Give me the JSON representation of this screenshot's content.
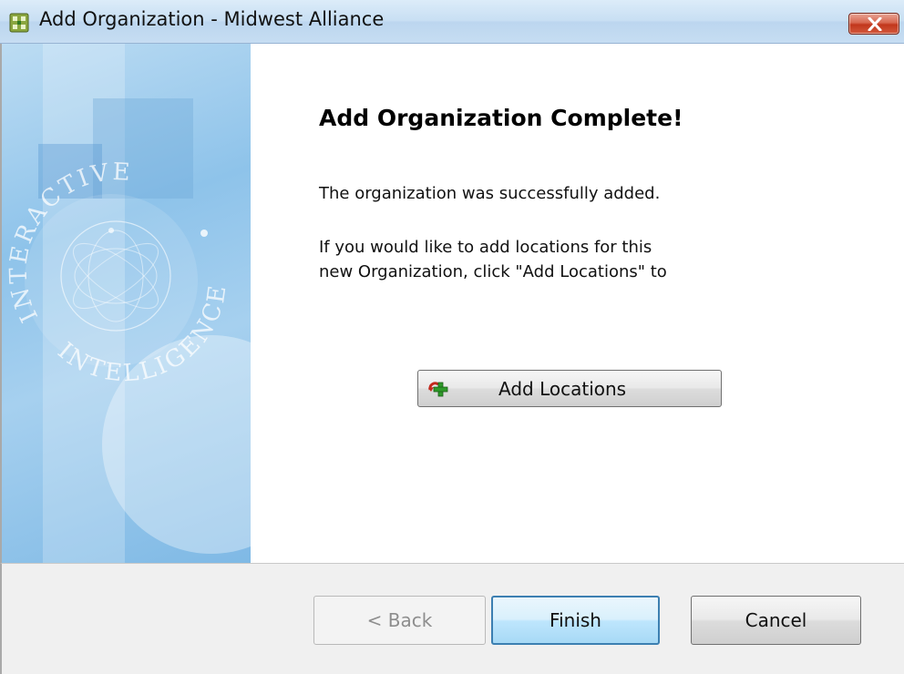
{
  "window": {
    "title": "Add Organization - Midwest Alliance",
    "icon": "app-grid-icon",
    "close_icon": "close-icon"
  },
  "banner": {
    "watermark_text": [
      "INTERACTIVE",
      "INTELLIGENCE"
    ],
    "colors": {
      "light": "#bcdcf3",
      "mid": "#8ec3ea",
      "dark": "#7fb9e5"
    }
  },
  "content": {
    "heading": "Add Organization Complete!",
    "message_1": "The organization was successfully added.",
    "message_2_line_1": "If you would like to add locations for this",
    "message_2_line_2": "new Organization, click \"Add Locations\" to",
    "add_locations_label": "Add Locations",
    "add_locations_icon": "add-location-icon"
  },
  "footer": {
    "back_label": "< Back",
    "finish_label": "Finish",
    "cancel_label": "Cancel",
    "back_enabled": false
  },
  "colors": {
    "title_bar": "#c8dff3",
    "close_button": "#c1371c",
    "default_button_border": "#3c7fb1"
  }
}
